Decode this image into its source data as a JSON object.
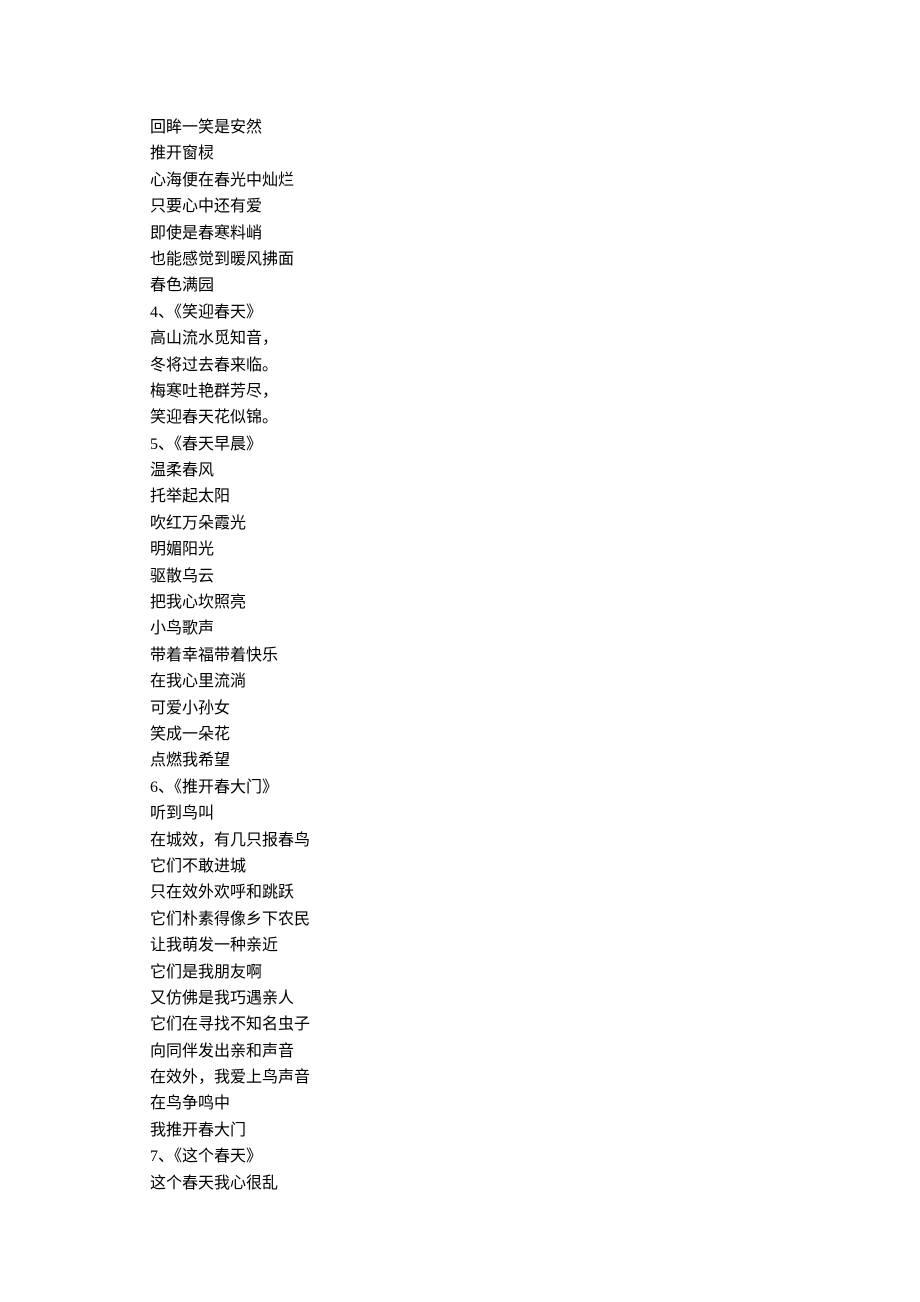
{
  "lines": [
    "回眸一笑是安然",
    "推开窗棂",
    "心海便在春光中灿烂",
    "只要心中还有爱",
    "即使是春寒料峭",
    "也能感觉到暖风拂面",
    "春色满园",
    "4、《笑迎春天》",
    "高山流水觅知音，",
    "冬将过去春来临。",
    "梅寒吐艳群芳尽，",
    "笑迎春天花似锦。",
    "5、《春天早晨》",
    "温柔春风",
    "托举起太阳",
    "吹红万朵霞光",
    "明媚阳光",
    "驱散乌云",
    "把我心坎照亮",
    "小鸟歌声",
    "带着幸福带着快乐",
    "在我心里流淌",
    "可爱小孙女",
    "笑成一朵花",
    "点燃我希望",
    "6、《推开春大门》",
    "听到鸟叫",
    "在城效，有几只报春鸟",
    "它们不敢进城",
    "只在效外欢呼和跳跃",
    "它们朴素得像乡下农民",
    "让我萌发一种亲近",
    "它们是我朋友啊",
    "又仿佛是我巧遇亲人",
    "它们在寻找不知名虫子",
    "向同伴发出亲和声音",
    "在效外，我爱上鸟声音",
    "在鸟争鸣中",
    "我推开春大门",
    "7、《这个春天》",
    "这个春天我心很乱"
  ]
}
